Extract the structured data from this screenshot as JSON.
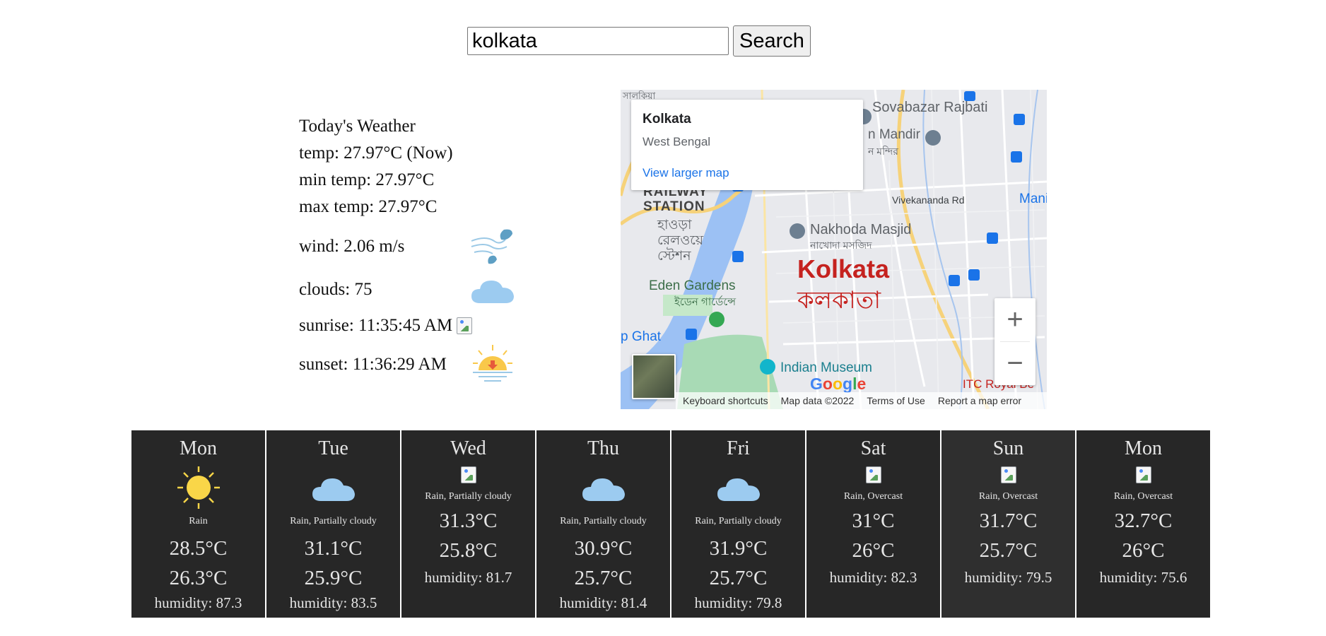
{
  "search": {
    "value": "kolkata",
    "button_label": "Search"
  },
  "today": {
    "heading": "Today's Weather",
    "temp": "temp: 27.97°C (Now)",
    "min_temp": "min temp: 27.97°C",
    "max_temp": "max temp: 27.97°C",
    "wind": "wind: 2.06 m/s",
    "clouds": "clouds: 75",
    "sunrise": "sunrise: 11:35:45 AM",
    "sunset": "sunset: 11:36:29 AM",
    "icons": {
      "wind": "wind-icon",
      "clouds": "cloud-icon",
      "sunrise": "broken-image-icon",
      "sunset": "sunset-icon"
    }
  },
  "map": {
    "place_title": "Kolkata",
    "place_subtitle": "West Bengal",
    "view_larger": "View larger map",
    "city_label": "Kolkata",
    "city_label_bn": "কলকাতা",
    "pois": {
      "sovabazar": "Sovabazar Rajbati",
      "mandir": "n Mandir",
      "mandir_bn": "ন মন্দির",
      "railway": "RAILWAY",
      "station": "STATION",
      "howrah_bn_1": "হাওড়া",
      "howrah_bn_2": "রেলওয়ে",
      "howrah_bn_3": "স্টেশন",
      "nakhoda": "Nakhoda Masjid",
      "nakhoda_bn": "নাখোদা মসজিদ",
      "eden": "Eden Gardens",
      "eden_bn": "ইডেন গার্ডেন্সে",
      "ghat": "p Ghat",
      "indian_museum": "Indian Museum",
      "itc": "ITC Royal Be",
      "vivekananda": "Vivekananda Rd",
      "mani": "Mani",
      "salkia": "সালকিয়া"
    },
    "zoom_in": "+",
    "zoom_out": "−",
    "google": "Google",
    "attribution": [
      "Keyboard shortcuts",
      "Map data ©2022",
      "Terms of Use",
      "Report a map error"
    ]
  },
  "forecast": [
    {
      "day": "Mon",
      "icon": "sun-icon",
      "condition": "Rain",
      "high": "28.5°C",
      "low": "26.3°C",
      "humidity": "humidity: 87.3"
    },
    {
      "day": "Tue",
      "icon": "cloud-icon",
      "condition": "Rain, Partially cloudy",
      "high": "31.1°C",
      "low": "25.9°C",
      "humidity": "humidity: 83.5"
    },
    {
      "day": "Wed",
      "icon": "broken-image-icon",
      "condition": "Rain, Partially cloudy",
      "high": "31.3°C",
      "low": "25.8°C",
      "humidity": "humidity: 81.7"
    },
    {
      "day": "Thu",
      "icon": "cloud-icon",
      "condition": "Rain, Partially cloudy",
      "high": "30.9°C",
      "low": "25.7°C",
      "humidity": "humidity: 81.4"
    },
    {
      "day": "Fri",
      "icon": "cloud-icon",
      "condition": "Rain, Partially cloudy",
      "high": "31.9°C",
      "low": "25.7°C",
      "humidity": "humidity: 79.8"
    },
    {
      "day": "Sat",
      "icon": "broken-image-icon",
      "condition": "Rain, Overcast",
      "high": "31°C",
      "low": "26°C",
      "humidity": "humidity: 82.3"
    },
    {
      "day": "Sun",
      "icon": "broken-image-icon",
      "condition": "Rain, Overcast",
      "high": "31.7°C",
      "low": "25.7°C",
      "humidity": "humidity: 79.5"
    },
    {
      "day": "Mon",
      "icon": "broken-image-icon",
      "condition": "Rain, Overcast",
      "high": "32.7°C",
      "low": "26°C",
      "humidity": "humidity: 75.6"
    }
  ],
  "colors": {
    "card_bg": "#272727",
    "card_text": "#e6e6e6",
    "cloud": "#9ccbf0",
    "sun": "#f9d648",
    "map_city": "#c5221f",
    "link": "#1a73e8"
  }
}
